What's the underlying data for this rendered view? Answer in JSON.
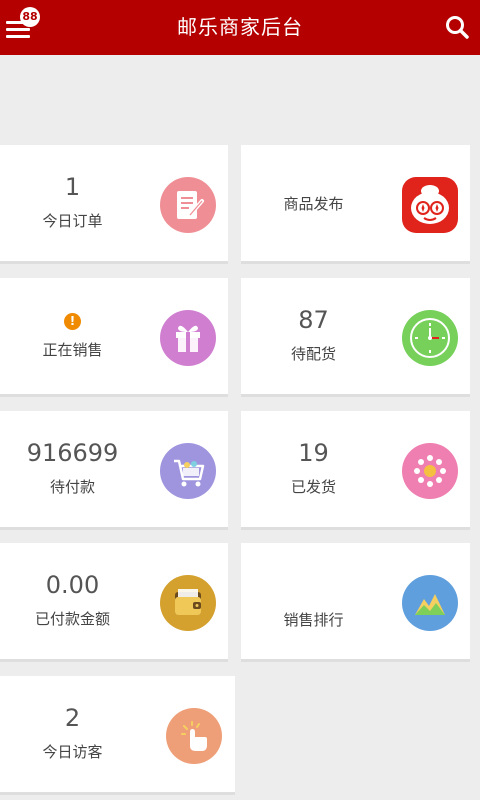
{
  "header": {
    "title": "邮乐商家后台",
    "badge": "88"
  },
  "cards": {
    "today_orders": {
      "value": "1",
      "label": "今日订单"
    },
    "publish": {
      "label": "商品发布"
    },
    "on_sale": {
      "label": "正在销售",
      "warning": "!"
    },
    "to_ship": {
      "value": "87",
      "label": "待配货"
    },
    "unpaid": {
      "value": "916699",
      "label": "待付款"
    },
    "shipped": {
      "value": "19",
      "label": "已发货"
    },
    "paid_amount": {
      "value": "0.00",
      "label": "已付款金额"
    },
    "sales_rank": {
      "label": "销售排行"
    },
    "visitors": {
      "value": "2",
      "label": "今日访客"
    }
  },
  "colors": {
    "header_bg": "#b50000",
    "orders_icon": "#ef8f95",
    "publish_icon": "#e0241c",
    "on_sale_icon": "#d07fd0",
    "to_ship_icon": "#76d05a",
    "unpaid_icon": "#9e95de",
    "shipped_icon": "#ef7fb0",
    "paid_icon": "#d4a02e",
    "rank_icon": "#5f9fde",
    "visitors_icon": "#ef9f78"
  }
}
